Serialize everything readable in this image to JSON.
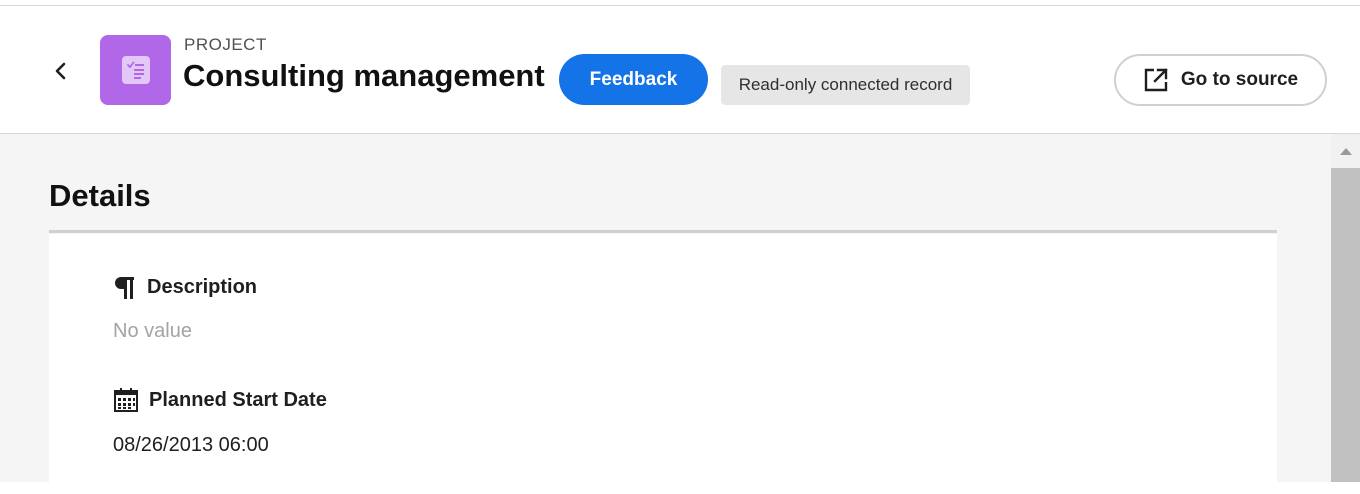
{
  "header": {
    "overline": "PROJECT",
    "title": "Consulting management",
    "feedback_label": "Feedback",
    "badge": "Read-only connected record",
    "go_to_source_label": "Go to source",
    "icons": {
      "back": "chevron-left-icon",
      "project": "project-checklist-icon",
      "source": "external-link-icon"
    },
    "colors": {
      "project_icon_bg": "#b067e8",
      "feedback_bg": "#1473e6"
    }
  },
  "details": {
    "heading": "Details",
    "fields": [
      {
        "label": "Description",
        "icon": "paragraph-icon",
        "value": "No value",
        "empty": true
      },
      {
        "label": "Planned Start Date",
        "icon": "calendar-icon",
        "value": "08/26/2013 06:00",
        "empty": false
      }
    ]
  }
}
